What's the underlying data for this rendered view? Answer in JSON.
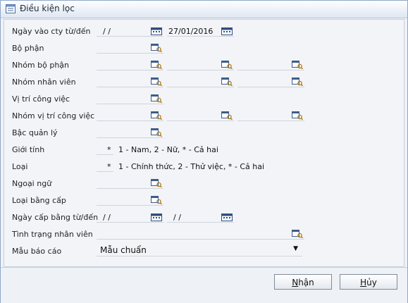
{
  "window": {
    "title": "Điều kiện lọc"
  },
  "form": {
    "labels": {
      "ngay_vao": "Ngày vào cty từ/đến",
      "bo_phan": "Bộ phận",
      "nhom_bo_phan": "Nhóm bộ phận",
      "nhom_nhan_vien": "Nhóm nhân viên",
      "vi_tri": "Vị trí công việc",
      "nhom_vi_tri": "Nhóm vị trí công việc",
      "bac_quan_ly": "Bậc quản lý",
      "gioi_tinh": "Giới tính",
      "loai": "Loại",
      "ngoai_ngu": "Ngoại ngữ",
      "loai_bang_cap": "Loại bằng cấp",
      "ngay_cap_bang": "Ngày cấp bằng từ/đến",
      "tinh_trang": "Tình trạng nhân viên",
      "mau_bao_cao": "Mẫu báo cáo"
    },
    "ngay_vao_from": "/  /",
    "ngay_vao_to": "27/01/2016",
    "ngay_cap_from": "/  /",
    "ngay_cap_to": "/  /",
    "gioi_tinh_value": "*",
    "gioi_tinh_hint": "1 - Nam, 2 - Nữ, * - Cả hai",
    "loai_value": "*",
    "loai_hint": "1 - Chính thức, 2 - Thử việc, * - Cả hai",
    "mau_bao_cao_value": "Mẫu chuẩn"
  },
  "buttons": {
    "ok_underlined": "N",
    "ok_rest": "hận",
    "cancel_underlined": "H",
    "cancel_rest": "ủy"
  },
  "icons": {
    "title": "form-icon",
    "lookup": "lookup-icon",
    "calendar": "calendar-icon",
    "dropdown": "chevron-down-icon"
  }
}
